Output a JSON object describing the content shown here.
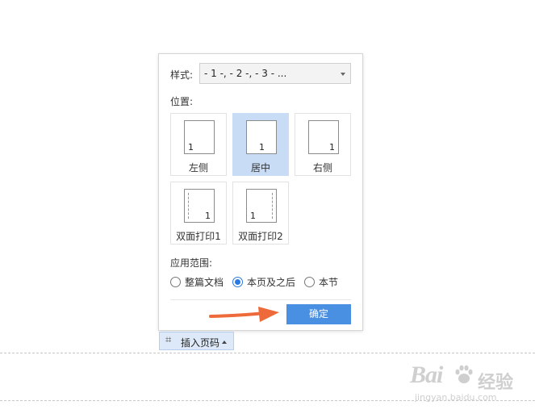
{
  "dialog": {
    "style_label": "样式:",
    "style_value": "- 1 -, - 2 -, - 3 - ...",
    "position_label": "位置:",
    "positions": [
      {
        "caption": "左侧",
        "number": "1"
      },
      {
        "caption": "居中",
        "number": "1"
      },
      {
        "caption": "右侧",
        "number": "1"
      },
      {
        "caption": "双面打印1",
        "number": "1"
      },
      {
        "caption": "双面打印2",
        "number": "1"
      }
    ],
    "selected_position": "居中",
    "scope_label": "应用范围:",
    "scope_options": [
      "整篇文档",
      "本页及之后",
      "本节"
    ],
    "scope_selected": "本页及之后",
    "ok_label": "确定"
  },
  "toolbar": {
    "insert_page_number_label": "插入页码",
    "insert_icon": "hash-icon"
  },
  "watermark": {
    "brand": "Bai",
    "brand_suffix": "经验",
    "url": "jingyan.baidu.com"
  },
  "colors": {
    "accent": "#4a90e2",
    "selected_tile": "#c9dcf5",
    "arrow": "#ee6a3a"
  }
}
